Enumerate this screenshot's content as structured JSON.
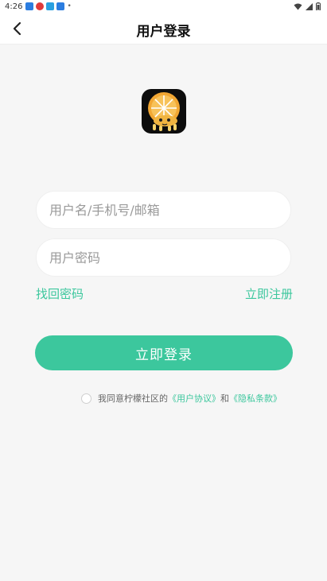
{
  "status_bar": {
    "time": "4:26",
    "dot": "•",
    "icons": [
      "vpn-key-icon",
      "news-app-icon",
      "cloud-icon",
      "shield-icon"
    ],
    "icon_colors": [
      "#2b7de0",
      "#e03a3a",
      "#2aa0e0",
      "#2b7de0"
    ]
  },
  "header": {
    "title": "用户登录",
    "back_icon": "chevron-left-icon"
  },
  "logo": {
    "icon": "orange-slice-mascot-icon",
    "bg_color": "#0d0d0d",
    "accent_color": "#f2a733"
  },
  "form": {
    "username_placeholder": "用户名/手机号/邮箱",
    "username_value": "",
    "password_placeholder": "用户密码",
    "password_value": ""
  },
  "links": {
    "forgot": "找回密码",
    "register": "立即注册"
  },
  "login_button": "立即登录",
  "agreement": {
    "checked": false,
    "prefix": "我同意柠檬社区的",
    "user_agreement": "《用户协议》",
    "and": "和",
    "privacy": "《隐私条款》"
  },
  "colors": {
    "accent": "#3cc79d",
    "background": "#f6f6f6"
  }
}
